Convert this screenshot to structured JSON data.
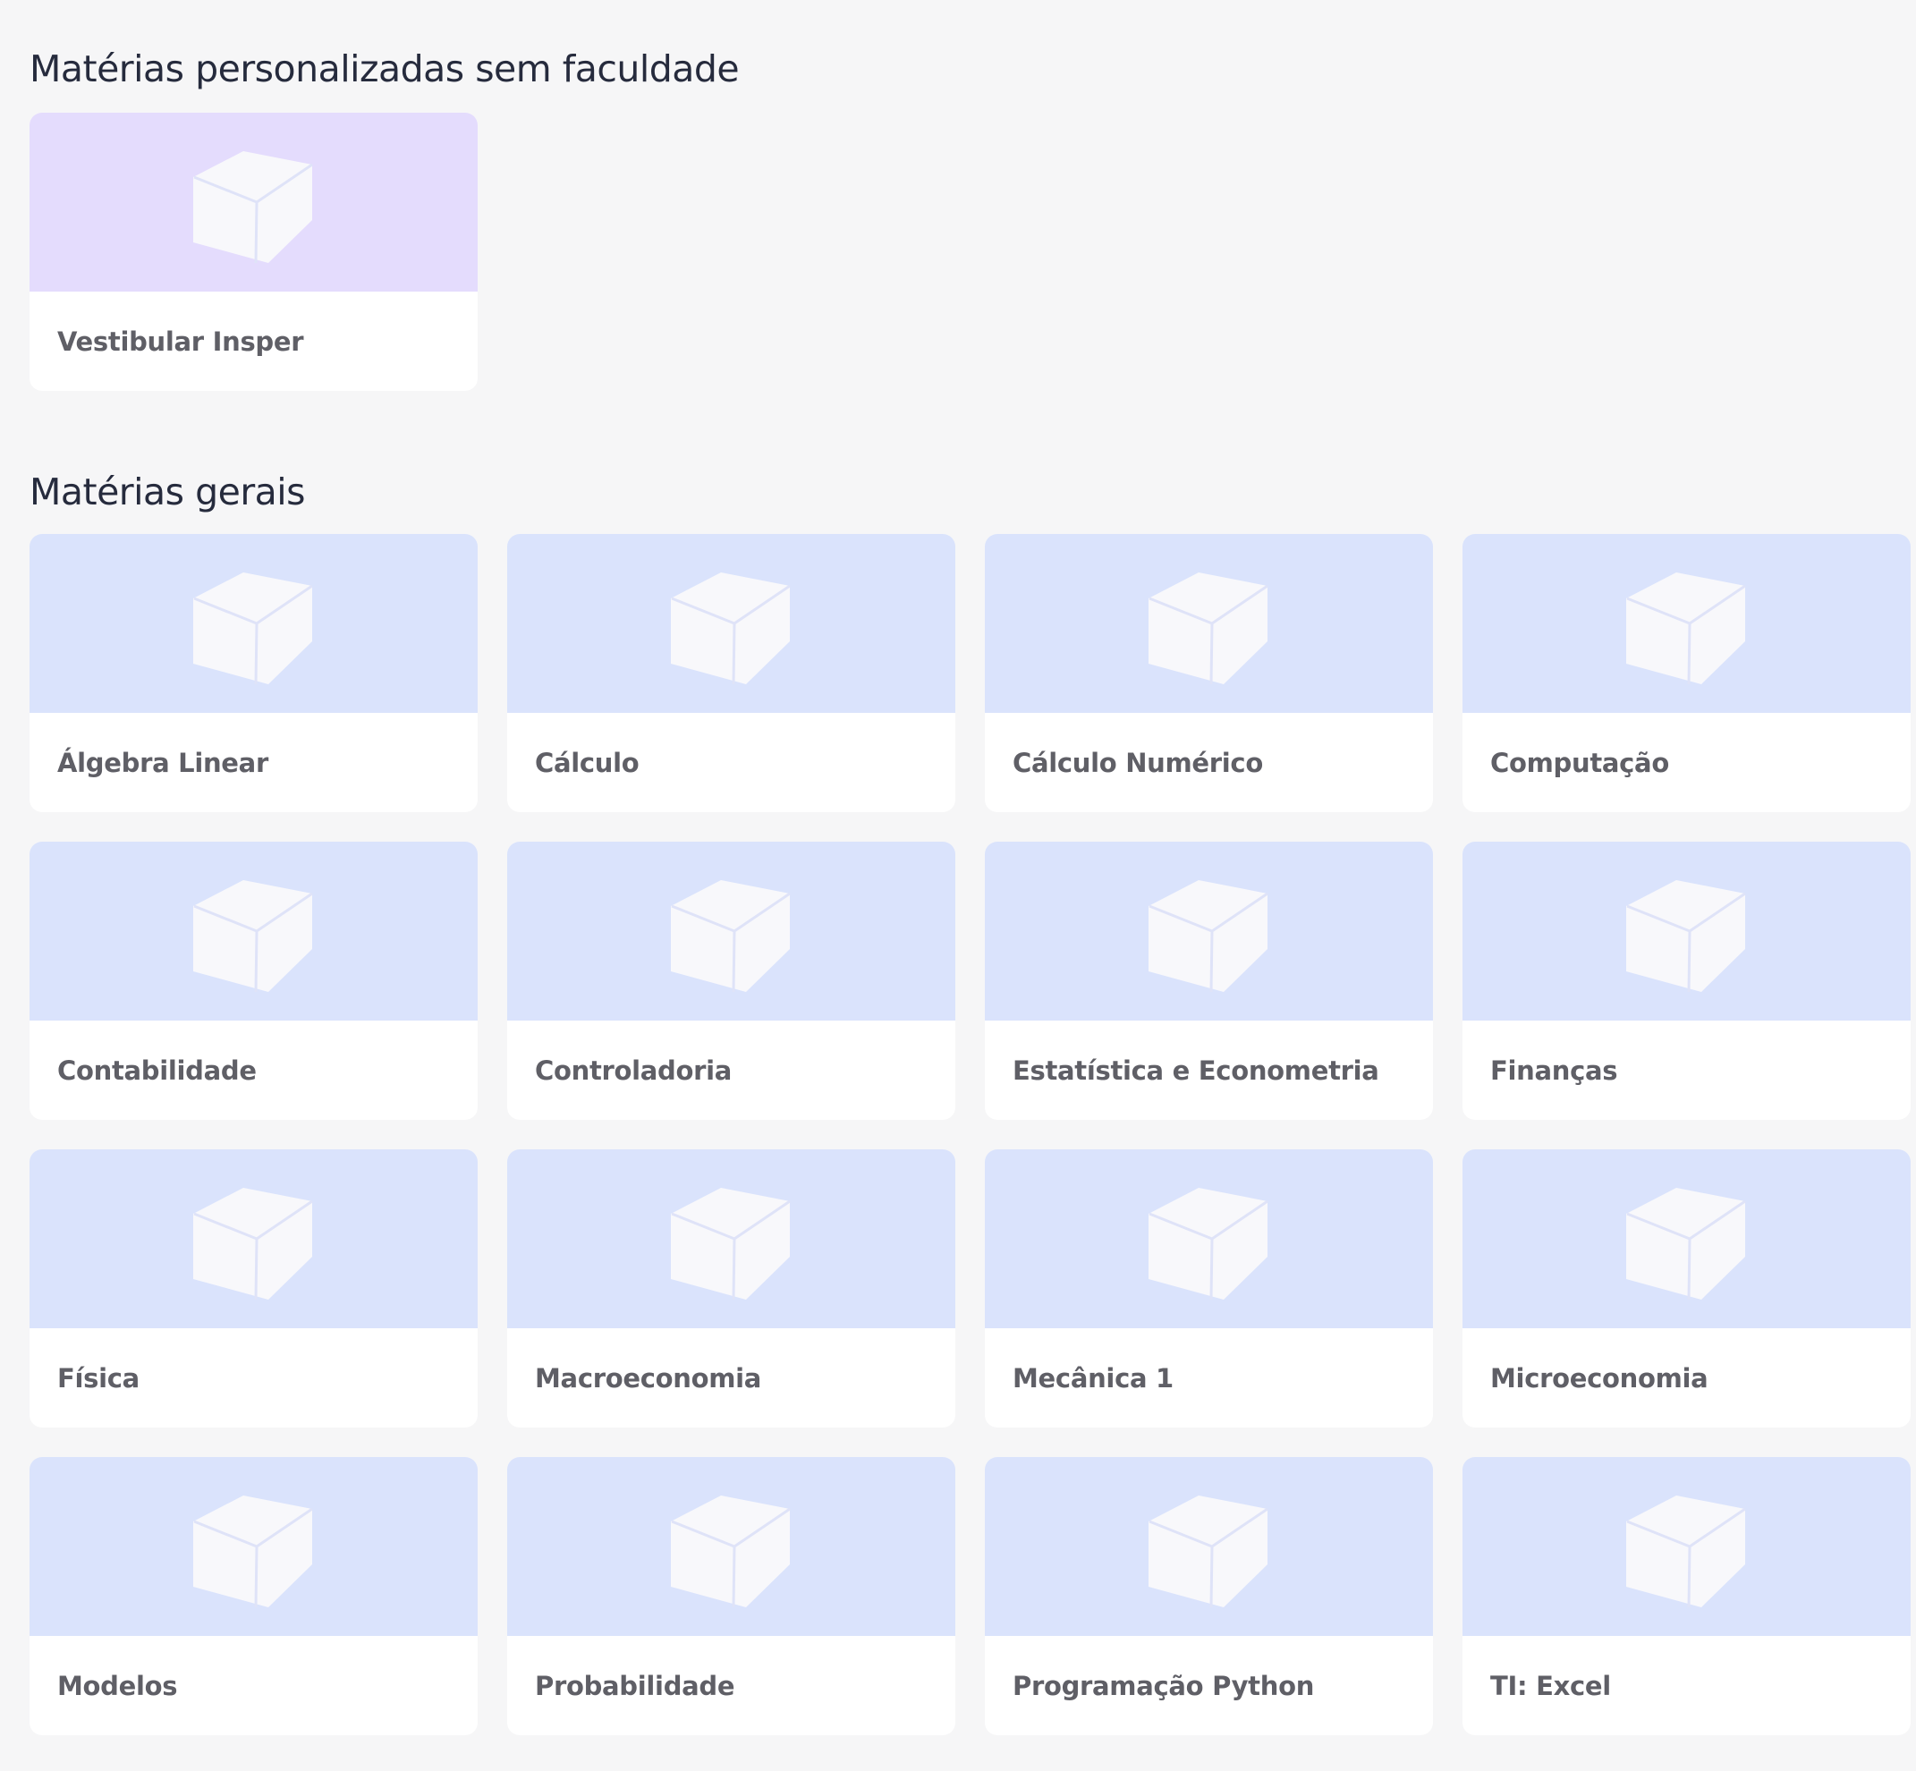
{
  "sections": {
    "personal": {
      "title": "Matérias personalizadas sem faculdade",
      "thumb_color": "#e4dcfd",
      "items": [
        {
          "label": "Vestibular Insper",
          "icon": "box-icon"
        }
      ]
    },
    "general": {
      "title": "Matérias gerais",
      "thumb_color": "#dae3fc",
      "items": [
        {
          "label": "Álgebra Linear",
          "icon": "box-icon"
        },
        {
          "label": "Cálculo",
          "icon": "box-icon"
        },
        {
          "label": "Cálculo Numérico",
          "icon": "box-icon"
        },
        {
          "label": "Computação",
          "icon": "box-icon"
        },
        {
          "label": "Contabilidade",
          "icon": "box-icon"
        },
        {
          "label": "Controladoria",
          "icon": "box-icon"
        },
        {
          "label": "Estatística e Econometria",
          "icon": "box-icon"
        },
        {
          "label": "Finanças",
          "icon": "box-icon"
        },
        {
          "label": "Física",
          "icon": "box-icon"
        },
        {
          "label": "Macroeconomia",
          "icon": "box-icon"
        },
        {
          "label": "Mecânica 1",
          "icon": "box-icon"
        },
        {
          "label": "Microeconomia",
          "icon": "box-icon"
        },
        {
          "label": "Modelos",
          "icon": "box-icon"
        },
        {
          "label": "Probabilidade",
          "icon": "box-icon"
        },
        {
          "label": "Programação Python",
          "icon": "box-icon"
        },
        {
          "label": "TI: Excel",
          "icon": "box-icon"
        }
      ]
    }
  }
}
